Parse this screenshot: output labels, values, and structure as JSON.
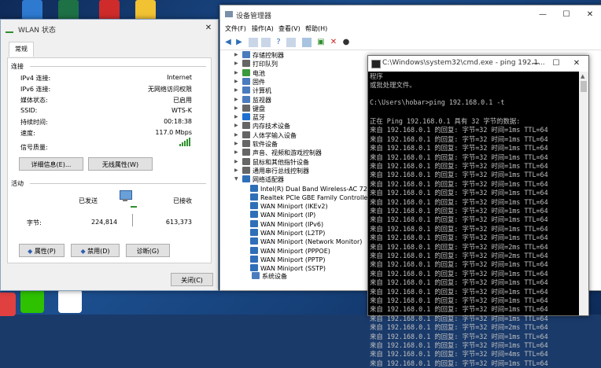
{
  "wlan": {
    "title": "WLAN 状态",
    "tab": "常规",
    "connection_header": "连接",
    "rows": [
      {
        "label": "IPv4 连接:",
        "value": "Internet"
      },
      {
        "label": "IPv6 连接:",
        "value": "无网络访问权限"
      },
      {
        "label": "媒体状态:",
        "value": "已启用"
      },
      {
        "label": "SSID:",
        "value": "WTS-K"
      },
      {
        "label": "持续时间:",
        "value": "00:18:38"
      },
      {
        "label": "速度:",
        "value": "117.0 Mbps"
      }
    ],
    "signal_label": "信号质量:",
    "details_button": "详细信息(E)...",
    "wireless_props_button": "无线属性(W)",
    "activity_header": "活动",
    "sent_label": "已发送",
    "received_label": "已接收",
    "bytes_label": "字节:",
    "bytes_sent": "224,814",
    "bytes_received": "613,373",
    "properties_button": "属性(P)",
    "disable_button": "禁用(D)",
    "diagnose_button": "诊断(G)",
    "close_button": "关闭(C)"
  },
  "devmgr": {
    "title": "设备管理器",
    "menu": [
      "文件(F)",
      "操作(A)",
      "查看(V)",
      "帮助(H)"
    ],
    "tree": [
      {
        "label": "存储控制器",
        "color": "#4a7bbd"
      },
      {
        "label": "打印队列",
        "color": "#666666"
      },
      {
        "label": "电池",
        "color": "#3b9a3b"
      },
      {
        "label": "固件",
        "color": "#4a7bbd"
      },
      {
        "label": "计算机",
        "color": "#4a7bbd"
      },
      {
        "label": "监视器",
        "color": "#4a7bbd"
      },
      {
        "label": "键盘",
        "color": "#666666"
      },
      {
        "label": "蓝牙",
        "color": "#1f6fd1"
      },
      {
        "label": "内存技术设备",
        "color": "#666666"
      },
      {
        "label": "人体学输入设备",
        "color": "#666666"
      },
      {
        "label": "软件设备",
        "color": "#666666"
      },
      {
        "label": "声音、视频和游戏控制器",
        "color": "#666666"
      },
      {
        "label": "鼠标和其他指针设备",
        "color": "#666666"
      },
      {
        "label": "通用串行总线控制器",
        "color": "#666666"
      },
      {
        "label": "网络适配器",
        "color": "#2f6fb8"
      }
    ],
    "adapters": [
      "Intel(R) Dual Band Wireless-AC 7260",
      "Realtek PCIe GBE Family Controller",
      "WAN Miniport (IKEv2)",
      "WAN Miniport (IP)",
      "WAN Miniport (IPv6)",
      "WAN Miniport (L2TP)",
      "WAN Miniport (Network Monitor)",
      "WAN Miniport (PPPOE)",
      "WAN Miniport (PPTP)",
      "WAN Miniport (SSTP)"
    ],
    "partial_item": "系统设备"
  },
  "cmd": {
    "title": "C:\\Windows\\system32\\cmd.exe - ping  192.1...",
    "lines": [
      "程序",
      "或批处理文件。",
      "",
      "C:\\Users\\hobar>ping 192.168.0.1 -t",
      "",
      "正在 Ping 192.168.0.1 具有 32 字节的数据:",
      "来自 192.168.0.1 的回复: 字节=32 时间=1ms TTL=64",
      "来自 192.168.0.1 的回复: 字节=32 时间=1ms TTL=64",
      "来自 192.168.0.1 的回复: 字节=32 时间=1ms TTL=64",
      "来自 192.168.0.1 的回复: 字节=32 时间=1ms TTL=64",
      "来自 192.168.0.1 的回复: 字节=32 时间=1ms TTL=64",
      "来自 192.168.0.1 的回复: 字节=32 时间=1ms TTL=64",
      "来自 192.168.0.1 的回复: 字节=32 时间=1ms TTL=64",
      "来自 192.168.0.1 的回复: 字节=32 时间=1ms TTL=64",
      "来自 192.168.0.1 的回复: 字节=32 时间=1ms TTL=64",
      "来自 192.168.0.1 的回复: 字节=32 时间=1ms TTL=64",
      "来自 192.168.0.1 的回复: 字节=32 时间=1ms TTL=64",
      "来自 192.168.0.1 的回复: 字节=32 时间=1ms TTL=64",
      "来自 192.168.0.1 的回复: 字节=32 时间=1ms TTL=64",
      "来自 192.168.0.1 的回复: 字节=32 时间=2ms TTL=64",
      "来自 192.168.0.1 的回复: 字节=32 时间=2ms TTL=64",
      "来自 192.168.0.1 的回复: 字节=32 时间=1ms TTL=64",
      "来自 192.168.0.1 的回复: 字节=32 时间=1ms TTL=64",
      "来自 192.168.0.1 的回复: 字节=32 时间=1ms TTL=64",
      "来自 192.168.0.1 的回复: 字节=32 时间=1ms TTL=64",
      "来自 192.168.0.1 的回复: 字节=32 时间=1ms TTL=64",
      "来自 192.168.0.1 的回复: 字节=32 时间=1ms TTL=64",
      "来自 192.168.0.1 的回复: 字节=32 时间=1ms TTL=64",
      "来自 192.168.0.1 的回复: 字节=32 时间=2ms TTL=64",
      "来自 192.168.0.1 的回复: 字节=32 时间=1ms TTL=64",
      "来自 192.168.0.1 的回复: 字节=32 时间=1ms TTL=64",
      "来自 192.168.0.1 的回复: 字节=32 时间=4ms TTL=64",
      "来自 192.168.0.1 的回复: 字节=32 时间=1ms TTL=64"
    ]
  }
}
